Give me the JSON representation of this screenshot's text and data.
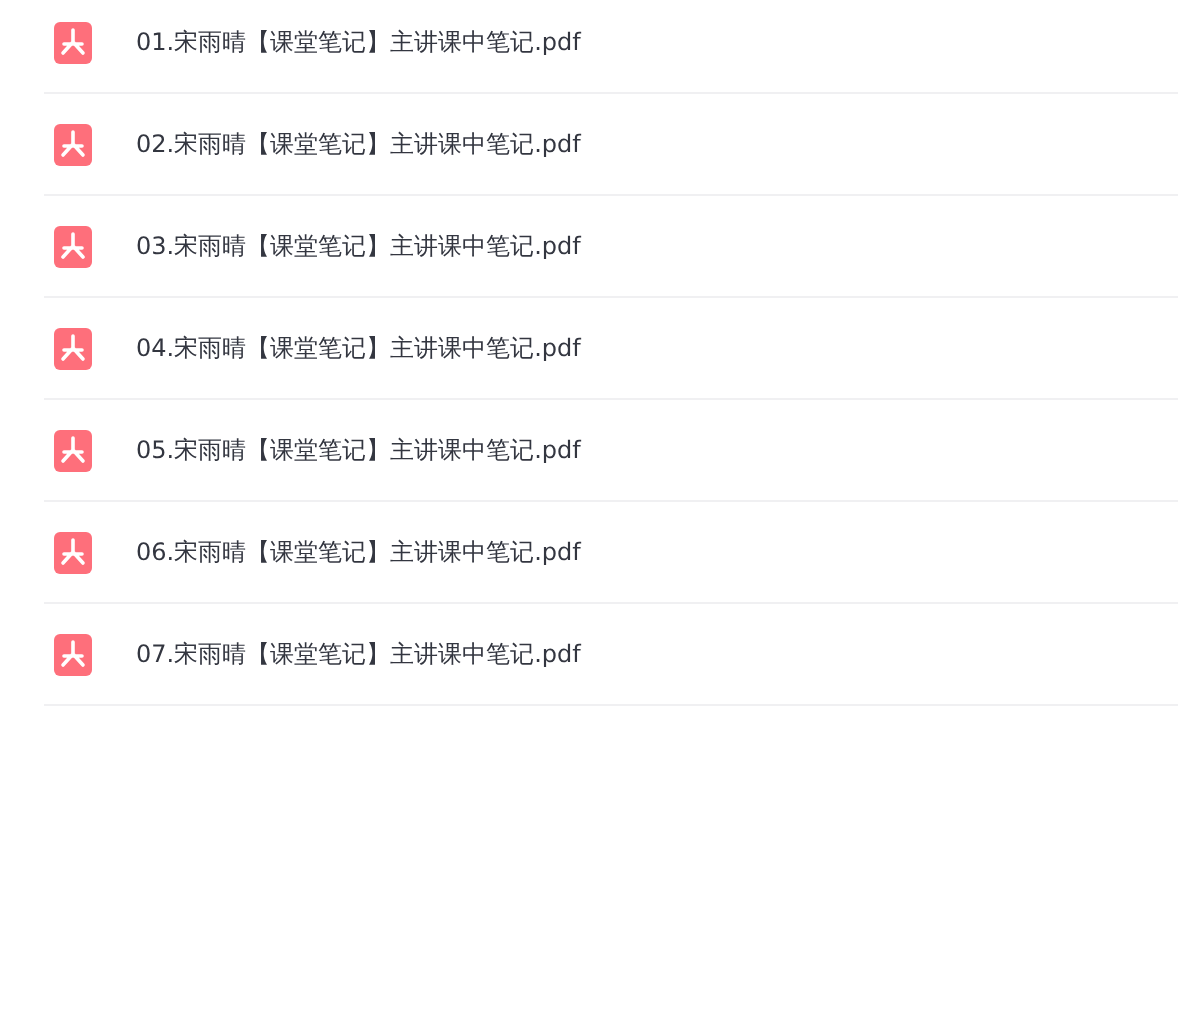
{
  "files": [
    {
      "name": "01.宋雨晴【课堂笔记】主讲课中笔记.pdf"
    },
    {
      "name": "02.宋雨晴【课堂笔记】主讲课中笔记.pdf"
    },
    {
      "name": "03.宋雨晴【课堂笔记】主讲课中笔记.pdf"
    },
    {
      "name": "04.宋雨晴【课堂笔记】主讲课中笔记.pdf"
    },
    {
      "name": "05.宋雨晴【课堂笔记】主讲课中笔记.pdf"
    },
    {
      "name": "06.宋雨晴【课堂笔记】主讲课中笔记.pdf"
    },
    {
      "name": "07.宋雨晴【课堂笔记】主讲课中笔记.pdf"
    }
  ]
}
